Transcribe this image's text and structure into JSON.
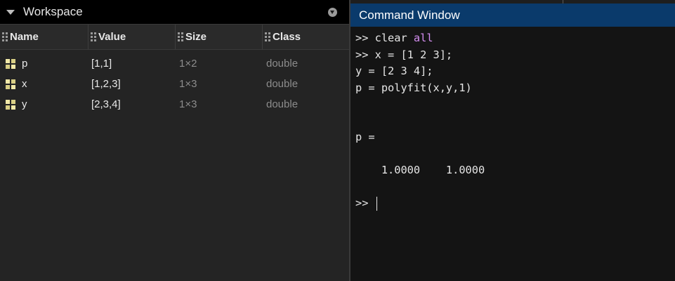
{
  "workspace": {
    "title": "Workspace",
    "columns": {
      "name": "Name",
      "value": "Value",
      "size": "Size",
      "class": "Class"
    },
    "variables": [
      {
        "name": "p",
        "value": "[1,1]",
        "size": "1×2",
        "class": "double"
      },
      {
        "name": "x",
        "value": "[1,2,3]",
        "size": "1×3",
        "class": "double"
      },
      {
        "name": "y",
        "value": "[2,3,4]",
        "size": "1×3",
        "class": "double"
      }
    ]
  },
  "command_window": {
    "title": "Command Window",
    "lines": {
      "l1_prompt": ">> ",
      "l1_cmd": "clear ",
      "l1_kw": "all",
      "l2": ">> x = [1 2 3];",
      "l3": "y = [2 3 4];",
      "l4": "p = polyfit(x,y,1)",
      "l7": "p =",
      "l9": "    1.0000    1.0000",
      "l11_prompt": ">> "
    }
  },
  "colors": {
    "command_title_bg": "#0a3a6b",
    "keyword": "#d48ef0",
    "matrix_icon": "#f2e9a8"
  },
  "icons": [
    "collapse-arrow-icon",
    "panel-menu-icon",
    "column-grip-icon",
    "matrix-variable-icon"
  ]
}
